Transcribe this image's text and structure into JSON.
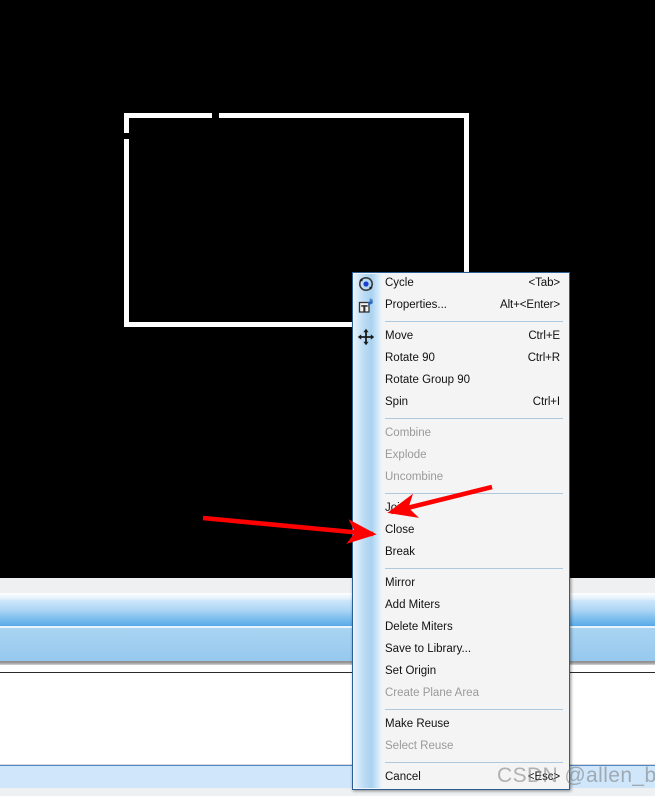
{
  "app": {
    "canvas_background": "#000000",
    "accent_color": "#2b5f94",
    "annotation_color": "#ff0000"
  },
  "canvas": {
    "shape_name": "open-rectangle-polyline",
    "shape_color": "#ffffff"
  },
  "context_menu": {
    "name": "cad-context-menu",
    "groups": [
      {
        "items": [
          {
            "label": "Cycle",
            "accel": "<Tab>",
            "enabled": true,
            "icon": "cycle-icon"
          },
          {
            "label": "Properties...",
            "accel": "Alt+<Enter>",
            "enabled": true,
            "icon": "properties-icon"
          }
        ]
      },
      {
        "items": [
          {
            "label": "Move",
            "accel": "Ctrl+E",
            "enabled": true,
            "icon": "move-icon"
          },
          {
            "label": "Rotate 90",
            "accel": "Ctrl+R",
            "enabled": true,
            "icon": ""
          },
          {
            "label": "Rotate Group 90",
            "accel": "",
            "enabled": true,
            "icon": ""
          },
          {
            "label": "Spin",
            "accel": "Ctrl+I",
            "enabled": true,
            "icon": ""
          }
        ]
      },
      {
        "items": [
          {
            "label": "Combine",
            "accel": "",
            "enabled": false,
            "icon": ""
          },
          {
            "label": "Explode",
            "accel": "",
            "enabled": false,
            "icon": ""
          },
          {
            "label": "Uncombine",
            "accel": "",
            "enabled": false,
            "icon": ""
          }
        ]
      },
      {
        "items": [
          {
            "label": "Join",
            "accel": "",
            "enabled": true,
            "icon": ""
          },
          {
            "label": "Close",
            "accel": "",
            "enabled": true,
            "icon": ""
          },
          {
            "label": "Break",
            "accel": "",
            "enabled": true,
            "icon": ""
          }
        ]
      },
      {
        "items": [
          {
            "label": "Mirror",
            "accel": "",
            "enabled": true,
            "icon": ""
          },
          {
            "label": "Add Miters",
            "accel": "",
            "enabled": true,
            "icon": ""
          },
          {
            "label": "Delete Miters",
            "accel": "",
            "enabled": true,
            "icon": ""
          },
          {
            "label": "Save to Library...",
            "accel": "",
            "enabled": true,
            "icon": ""
          },
          {
            "label": "Set Origin",
            "accel": "",
            "enabled": true,
            "icon": ""
          },
          {
            "label": "Create Plane Area",
            "accel": "",
            "enabled": false,
            "icon": ""
          }
        ]
      },
      {
        "items": [
          {
            "label": "Make Reuse",
            "accel": "",
            "enabled": true,
            "icon": ""
          },
          {
            "label": "Select Reuse",
            "accel": "",
            "enabled": false,
            "icon": ""
          }
        ]
      },
      {
        "items": [
          {
            "label": "Cancel",
            "accel": "<Esc>",
            "enabled": true,
            "icon": ""
          }
        ]
      }
    ]
  },
  "annotations": [
    {
      "name": "arrow-pointing-to-join",
      "target": "Join",
      "color": "#ff0000"
    },
    {
      "name": "arrow-pointing-to-close",
      "target": "Close",
      "color": "#ff0000"
    }
  ],
  "watermark": {
    "text": "CSDN @allen_bllen"
  }
}
